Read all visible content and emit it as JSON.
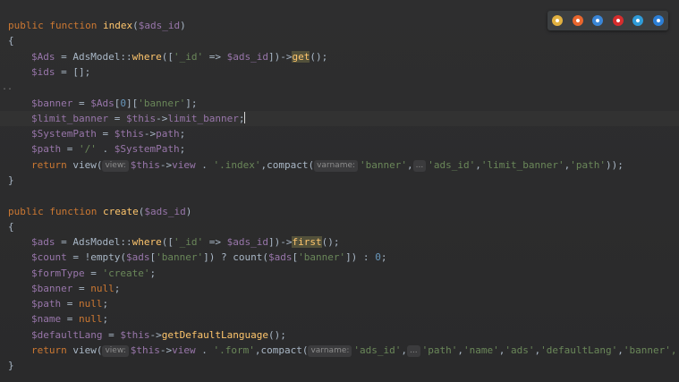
{
  "browser_icons": [
    {
      "name": "chrome-icon",
      "color": "#e0b040"
    },
    {
      "name": "firefox-icon",
      "color": "#e8662e"
    },
    {
      "name": "safari-icon",
      "color": "#3a86d6"
    },
    {
      "name": "opera-icon",
      "color": "#d62d2d"
    },
    {
      "name": "ie-icon",
      "color": "#2f9bd8"
    },
    {
      "name": "edge-icon",
      "color": "#2c7fd6"
    }
  ],
  "code": {
    "fold_marker": "..",
    "l1": {
      "kw": "public function ",
      "fn": "index",
      "p1": "(",
      "v": "$ads_id",
      "p2": ")"
    },
    "l2": "{",
    "l3": {
      "v1": "$Ads",
      "a": " = AdsModel::",
      "m": "where",
      "b": "([",
      "s1": "'_id'",
      "c": " => ",
      "v2": "$ads_id",
      "d": "])->",
      "g": "get",
      "e": "();"
    },
    "l4": {
      "v": "$ids",
      "a": " = [];"
    },
    "l5": {
      "v1": "$banner",
      "a": " = ",
      "v2": "$Ads",
      "b": "[",
      "n": "0",
      "c": "][",
      "s": "'banner'",
      "d": "];"
    },
    "l6": {
      "v1": "$limit_banner",
      "a": " = ",
      "v2": "$this",
      "b": "->",
      "p": "limit_banner",
      "c": ";"
    },
    "l7": {
      "v1": "$SystemPath",
      "a": " = ",
      "v2": "$this",
      "b": "->",
      "p": "path",
      "c": ";"
    },
    "l8": {
      "v": "$path",
      "a": " = ",
      "s": "'/'",
      "b": " . ",
      "v2": "$SystemPath",
      "c": ";"
    },
    "l9": {
      "kw": "return ",
      "a": "view(",
      "h1": "view:",
      "v": "$this",
      "b": "->",
      "p": "view",
      "c": " . ",
      "s1": "'.index'",
      "d": ",compact(",
      "h2": "varname:",
      "s2": "'banner'",
      "e": ",",
      "h3": "...",
      "s3": "'ads_id'",
      "f": ",",
      "s4": "'limit_banner'",
      "g": ",",
      "s5": "'path'",
      "h": "));"
    },
    "l10": "}",
    "l11": {
      "kw": "public function ",
      "fn": "create",
      "p1": "(",
      "v": "$ads_id",
      "p2": ")"
    },
    "l12": "{",
    "l13": {
      "v1": "$ads",
      "a": " = AdsModel::",
      "m": "where",
      "b": "([",
      "s1": "'_id'",
      "c": " => ",
      "v2": "$ads_id",
      "d": "])->",
      "g": "first",
      "e": "();"
    },
    "l14": {
      "v": "$count",
      "a": " = !empty(",
      "v2": "$ads",
      "b": "[",
      "s": "'banner'",
      "c": "]) ? count(",
      "v3": "$ads",
      "d": "[",
      "s2": "'banner'",
      "e": "]) : ",
      "n": "0",
      "f": ";"
    },
    "l15": {
      "v": "$formType",
      "a": " = ",
      "s": "'create'",
      "b": ";"
    },
    "l16": {
      "v": "$banner",
      "a": " = ",
      "k": "null",
      "b": ";"
    },
    "l17": {
      "v": "$path",
      "a": " = ",
      "k": "null",
      "b": ";"
    },
    "l18": {
      "v": "$name",
      "a": " = ",
      "k": "null",
      "b": ";"
    },
    "l19": {
      "v": "$defaultLang",
      "a": " = ",
      "v2": "$this",
      "b": "->",
      "m": "getDefaultLanguage",
      "c": "();"
    },
    "l20": {
      "kw": "return ",
      "a": "view(",
      "h1": "view:",
      "v": "$this",
      "b": "->",
      "p": "view",
      "c": " . ",
      "s1": "'.form'",
      "d": ",compact(",
      "h2": "varname:",
      "s2": "'ads_id'",
      "e": ",",
      "h3": "...",
      "s3": "'path'",
      "f": ",",
      "s4": "'name'",
      "g": ",",
      "s5": "'ads'",
      "h": ",",
      "s6": "'defaultLang'",
      "i": ",",
      "s7": "'banner'",
      "j": ",'"
    },
    "l21": "}"
  }
}
